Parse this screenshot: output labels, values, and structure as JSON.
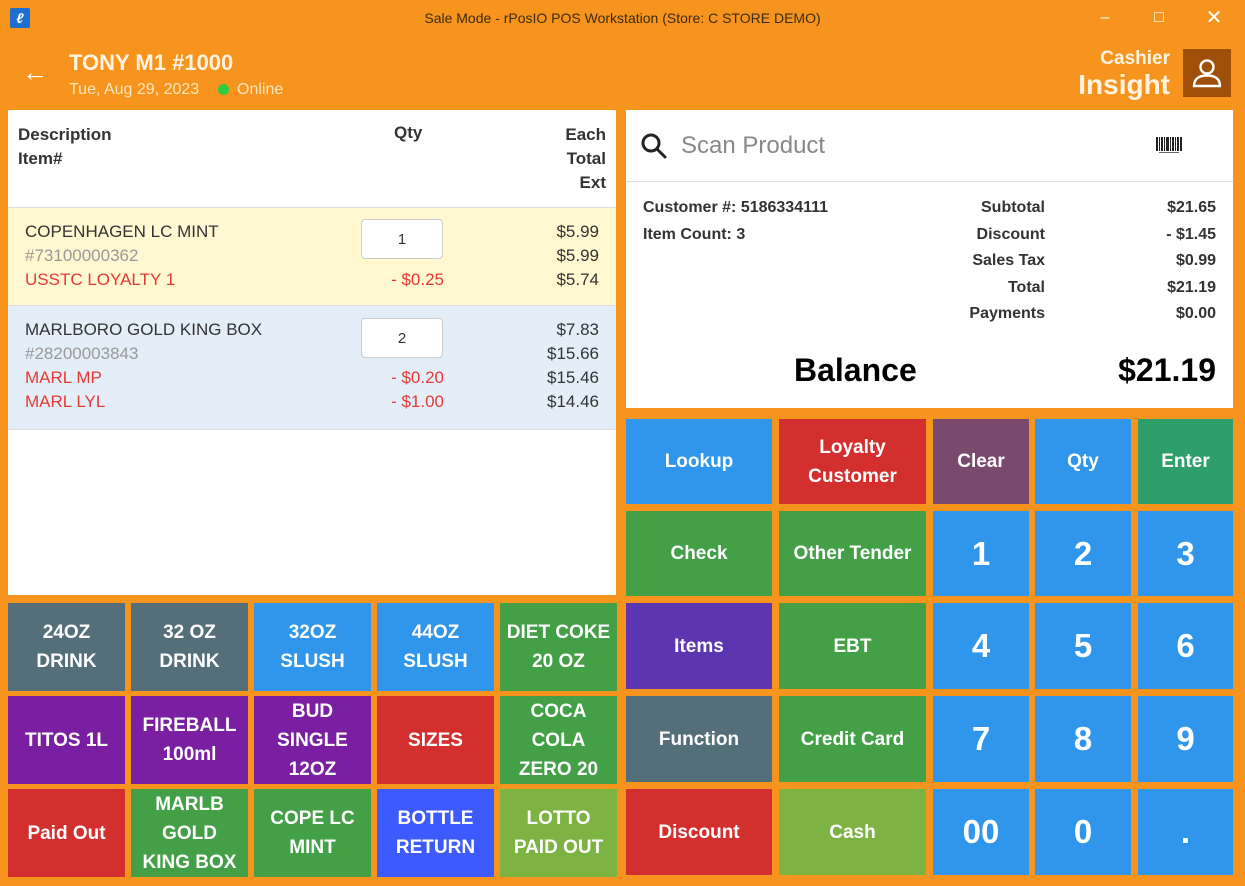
{
  "window": {
    "title": "Sale Mode - rPosIO POS Workstation (Store: C STORE DEMO)",
    "app_icon": "rposio-logo",
    "minimize": "–",
    "maximize": "□",
    "close": "✕"
  },
  "header": {
    "back_icon": "←",
    "terminal": "TONY M1 #1000",
    "date": "Tue, Aug 29, 2023",
    "status": "Online",
    "status_color": "#2ecc40",
    "cashier_label": "Cashier",
    "cashier_name": "Insight",
    "avatar_icon": "user-icon"
  },
  "receipt": {
    "headers": {
      "description": "Description",
      "item_num": "Item#",
      "qty": "Qty",
      "each": "Each",
      "total": "Total",
      "ext": "Ext"
    },
    "items": [
      {
        "name": "COPENHAGEN LC MINT",
        "number": "#73100000362",
        "qty": "1",
        "each": "$5.99",
        "total": "$5.99",
        "promos": [
          {
            "name": "USSTC LOYALTY 1",
            "amount": "- $0.25",
            "ext": "$5.74"
          }
        ]
      },
      {
        "name": "MARLBORO GOLD KING BOX",
        "number": "#28200003843",
        "qty": "2",
        "each": "$7.83",
        "total": "$15.66",
        "promos": [
          {
            "name": "MARL MP",
            "amount": "- $0.20",
            "ext": "$15.46"
          },
          {
            "name": "MARL LYL",
            "amount": "- $1.00",
            "ext": "$14.46"
          }
        ]
      }
    ]
  },
  "search": {
    "placeholder": "Scan Product",
    "icon": "search-icon",
    "barcode_icon": "barcode-icon"
  },
  "summary": {
    "customer_label": "Customer #:",
    "customer": "5186334111",
    "item_count_label": "Item Count:",
    "item_count": "3",
    "subtotal_label": "Subtotal",
    "subtotal": "$21.65",
    "discount_label": "Discount",
    "discount": "- $1.45",
    "tax_label": "Sales Tax",
    "tax": "$0.99",
    "total_label": "Total",
    "total": "$21.19",
    "payments_label": "Payments",
    "payments": "$0.00",
    "balance_label": "Balance",
    "balance": "$21.19"
  },
  "hotkeys": [
    [
      "24OZ",
      "DRINK"
    ],
    [
      "32 OZ",
      "DRINK"
    ],
    [
      "32OZ",
      "SLUSH"
    ],
    [
      "44OZ",
      "SLUSH"
    ],
    [
      "DIET COKE",
      "20 OZ"
    ],
    [
      "TITOS 1L"
    ],
    [
      "FIREBALL",
      "100ml"
    ],
    [
      "BUD",
      "SINGLE",
      "12OZ"
    ],
    [
      "SIZES"
    ],
    [
      "COCA",
      "COLA",
      "ZERO 20"
    ],
    [
      "Paid Out"
    ],
    [
      "MARLB",
      "GOLD",
      "KING BOX"
    ],
    [
      "COPE LC",
      "MINT"
    ],
    [
      "BOTTLE",
      "RETURN"
    ],
    [
      "LOTTO",
      "PAID OUT"
    ]
  ],
  "function_keys": {
    "lookup": "Lookup",
    "loyalty": [
      "Loyalty",
      "Customer"
    ],
    "clear": "Clear",
    "qty": "Qty",
    "enter": "Enter",
    "check": "Check",
    "other_tender": "Other Tender",
    "items": "Items",
    "ebt": "EBT",
    "function": "Function",
    "credit_card": "Credit Card",
    "discount": "Discount",
    "cash": "Cash"
  },
  "numpad": [
    "1",
    "2",
    "3",
    "4",
    "5",
    "6",
    "7",
    "8",
    "9",
    "00",
    "0",
    "."
  ],
  "colors": {
    "orange": "#f7941d",
    "slate": "#546e7a",
    "blue": "#2f96ec",
    "green": "#43a047",
    "light_green": "#7cb342",
    "red": "#d32f2f",
    "purple": "#7b1fa2",
    "deep_purple": "#5e35b1",
    "plum": "#7a4a6e",
    "royal_blue": "#3d5afe",
    "teal_green": "#2e9e6a"
  }
}
